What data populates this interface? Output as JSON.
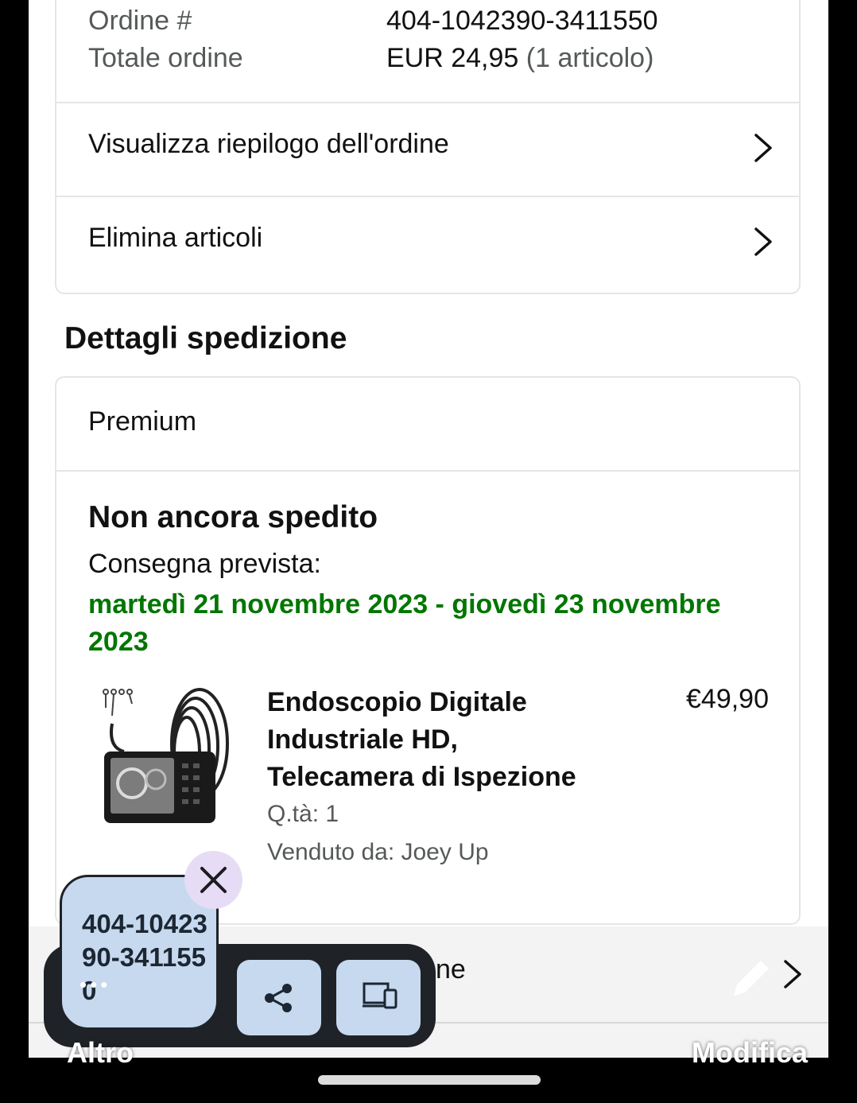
{
  "order": {
    "number_label": "Ordine #",
    "number_value": "404-1042390-3411550",
    "total_label": "Totale ordine",
    "total_value": "EUR 24,95",
    "total_count": "(1 articolo)"
  },
  "links": {
    "summary": "Visualizza riepilogo dell'ordine",
    "delete": "Elimina articoli"
  },
  "shipping": {
    "title": "Dettagli spedizione",
    "type": "Premium",
    "status": "Non ancora spedito",
    "eta_label": "Consegna prevista:",
    "eta_dates": "martedì 21 novembre 2023 - giovedì 23 novembre 2023",
    "eta_color": "#007600"
  },
  "product": {
    "title": "Endoscopio Digitale Industriale HD, Telecamera di Ispezione",
    "price": "€49,90",
    "qty": "Q.tà: 1",
    "seller": "Venduto da: Joey Up",
    "image_icon": "endoscope-camera-product-image"
  },
  "partial_row": {
    "text": "ne"
  },
  "overlay": {
    "copied_text": "404-1042390-3411550",
    "dots": "•••",
    "share_icon": "share-icon",
    "device_icon": "devices-icon",
    "close_icon": "close-icon",
    "left_action": "Altro",
    "right_action": "Modifica",
    "accent": "#c6d9ee"
  }
}
